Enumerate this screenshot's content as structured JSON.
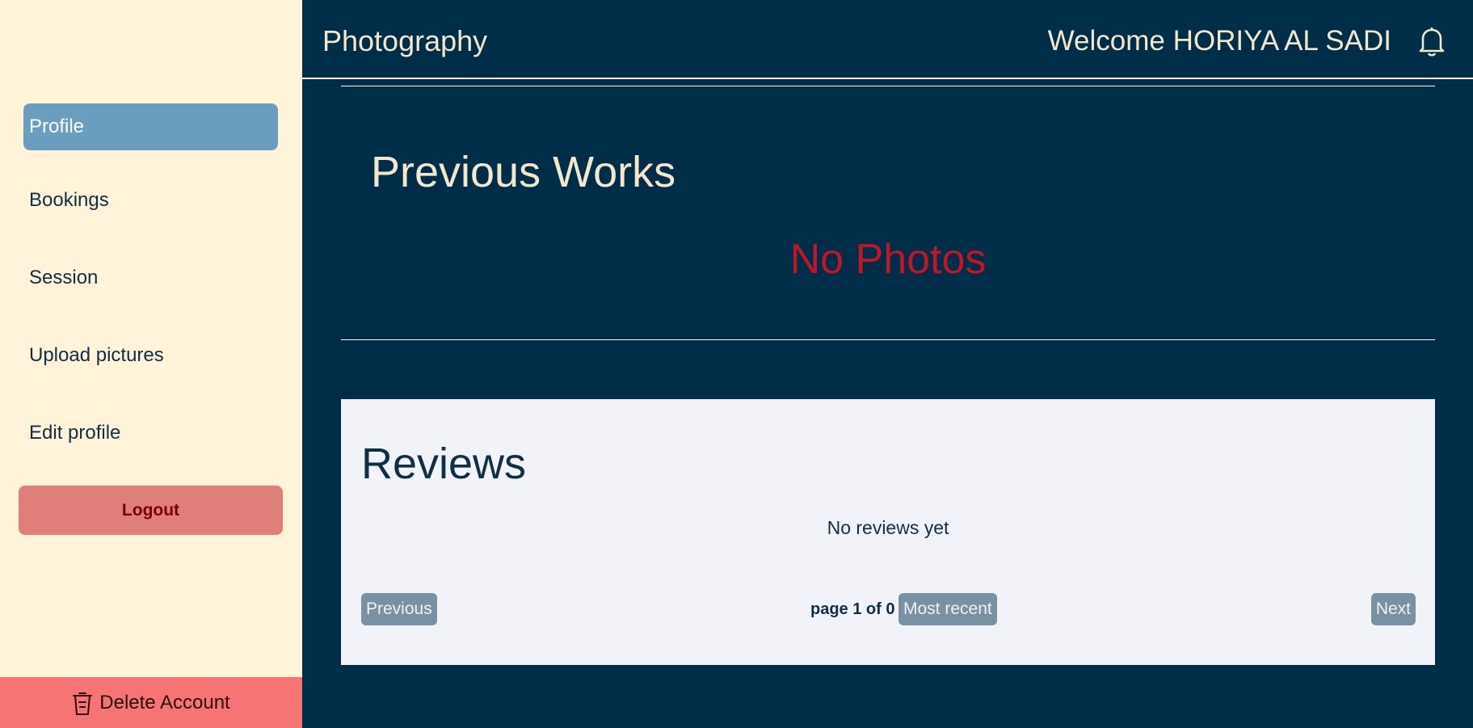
{
  "sidebar": {
    "items": [
      {
        "label": "Profile"
      },
      {
        "label": "Bookings"
      },
      {
        "label": "Session"
      },
      {
        "label": "Upload pictures"
      },
      {
        "label": "Edit profile"
      }
    ],
    "logout_label": "Logout",
    "delete_account_label": "Delete Account",
    "delete_icon": "trash-icon"
  },
  "header": {
    "title": "Photography",
    "welcome": "Welcome HORIYA AL SADI",
    "notification_icon": "bell-icon"
  },
  "works": {
    "title": "Previous Works",
    "empty_message": "No Photos"
  },
  "reviews": {
    "title": "Reviews",
    "empty_message": "No reviews yet",
    "previous_label": "Previous",
    "page_info": "page 1 of 0",
    "sort_label": "Most recent",
    "next_label": "Next"
  },
  "colors": {
    "background": "#002d47",
    "sidebar": "#fff3d9",
    "active_item": "#6a9ebf",
    "logout": "#e07f7a",
    "delete_account": "#f77474",
    "no_photos_text": "#c0162a",
    "reviews_panel": "#f2f3f9"
  }
}
